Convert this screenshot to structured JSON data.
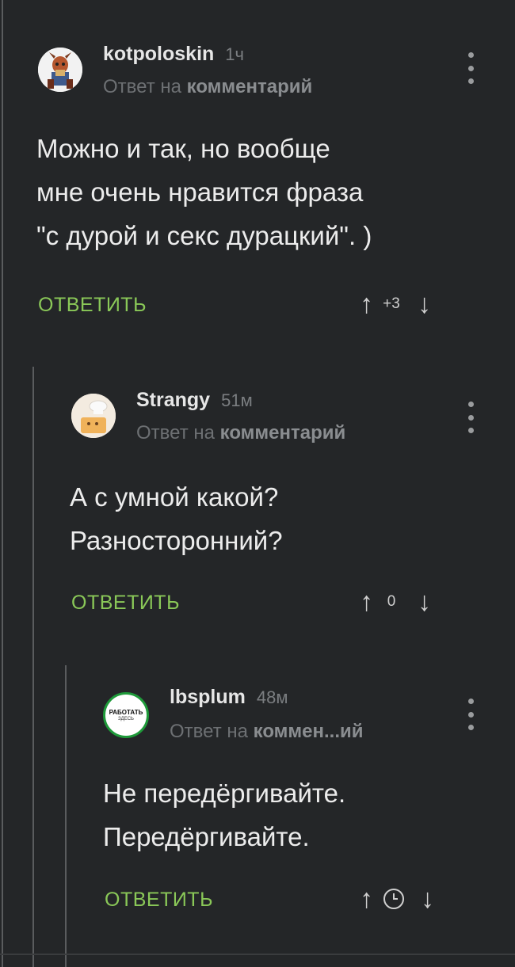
{
  "comments": [
    {
      "author": "kotpoloskin",
      "time": "1ч",
      "reply_prefix": "Ответ на",
      "reply_target": "комментарий",
      "text_lines": [
        "Можно и так, но вообще",
        "мне очень нравится фраза",
        "\"с дурой и секс дурацкий\". )"
      ],
      "reply_label": "ОТВЕТИТЬ",
      "score": "+3"
    },
    {
      "author": "Strangy",
      "time": "51м",
      "reply_prefix": "Ответ на",
      "reply_target": "комментарий",
      "text_lines": [
        "А с умной какой?",
        "Разносторонний?"
      ],
      "reply_label": "ОТВЕТИТЬ",
      "score": "0"
    },
    {
      "author": "lbsplum",
      "time": "48м",
      "reply_prefix": "Ответ на",
      "reply_target": "коммен...ий",
      "text_lines": [
        "Не передёргивайте.",
        "Передёргивайте."
      ],
      "reply_label": "ОТВЕТИТЬ",
      "score_icon": "clock-icon",
      "avatar_text": [
        "РАБОТАТЬ",
        "ЗДЕСЬ"
      ]
    }
  ],
  "icons": {
    "upvote": "up-arrow-icon",
    "downvote": "down-arrow-icon",
    "menu": "more-vertical-icon"
  },
  "colors": {
    "background": "#242628",
    "reply_button": "#8ac858",
    "thread_line": "#5a5c5e"
  }
}
